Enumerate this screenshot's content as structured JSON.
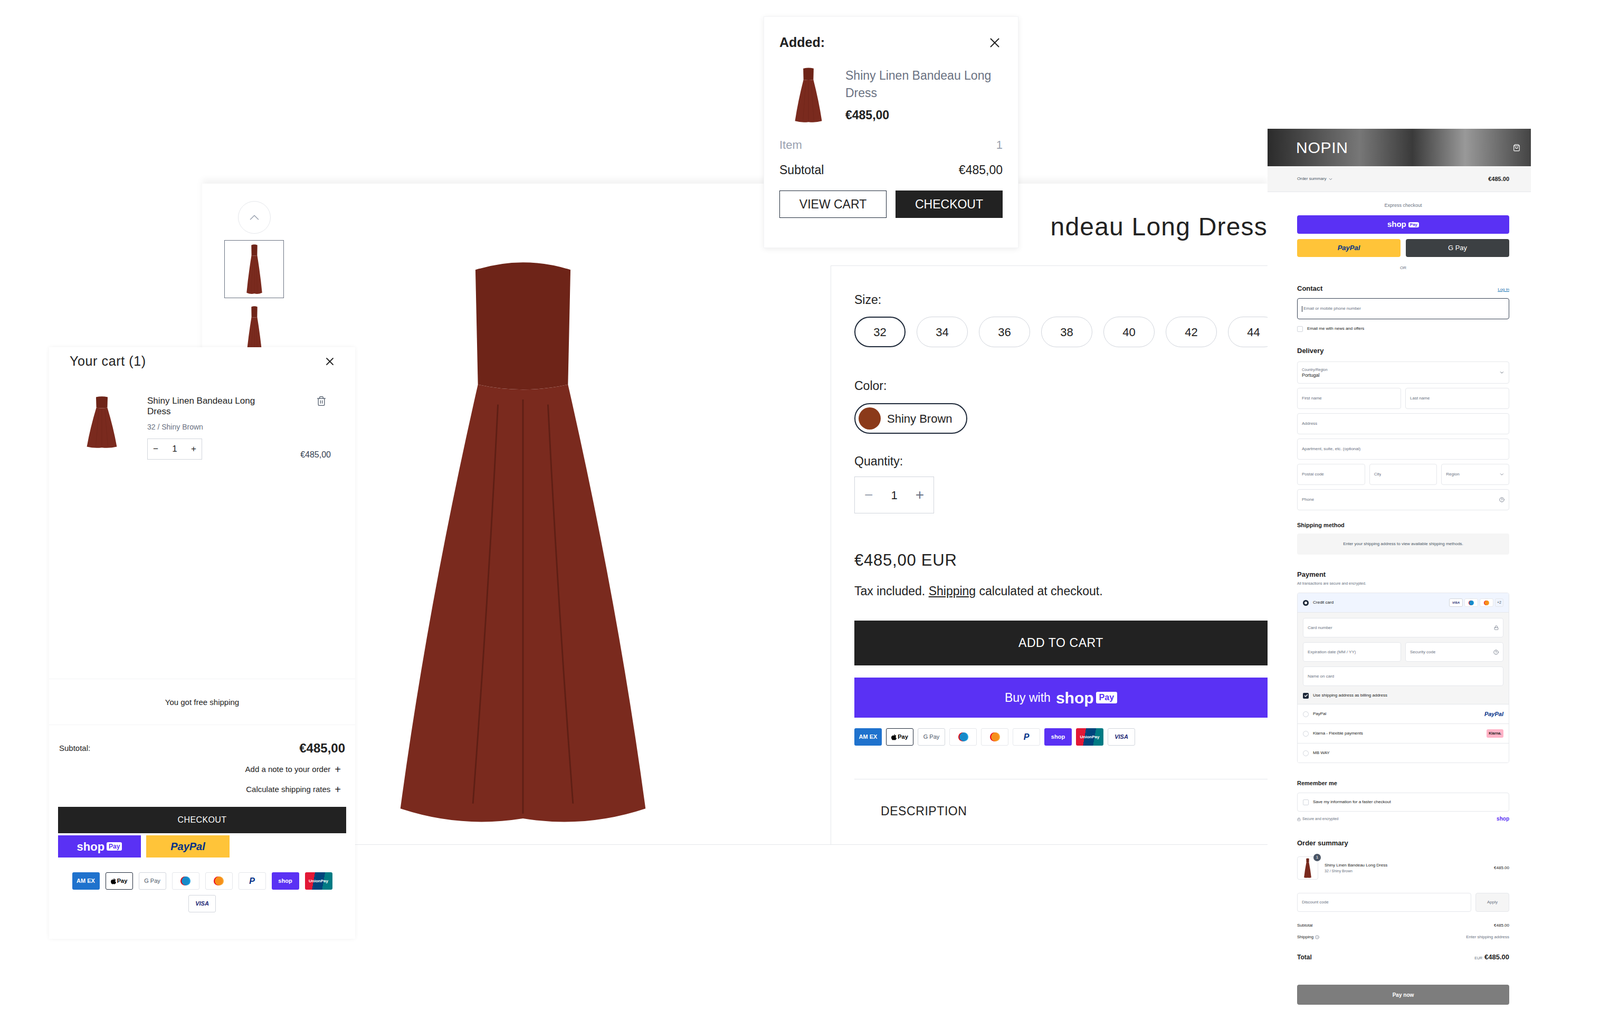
{
  "product_page": {
    "title_visible": "ndeau Long Dress",
    "size_label": "Size:",
    "sizes": [
      {
        "label": "32",
        "selected": true
      },
      {
        "label": "34",
        "selected": false
      },
      {
        "label": "36",
        "selected": false
      },
      {
        "label": "38",
        "selected": false
      },
      {
        "label": "40",
        "selected": false
      },
      {
        "label": "42",
        "selected": false
      },
      {
        "label": "44",
        "selected": false
      }
    ],
    "color_label": "Color:",
    "colors": [
      {
        "label": "Shiny Brown",
        "selected": true,
        "color": "#8b3a1a"
      }
    ],
    "quantity_label": "Quantity:",
    "quantity": {
      "decrement": "−",
      "value": "1",
      "increment": "+"
    },
    "price": "€485,00 EUR",
    "tax_before": "Tax included. ",
    "tax_link": "Shipping",
    "tax_after": " calculated at checkout.",
    "add_to_cart": "ADD TO CART",
    "buy_with": "Buy with",
    "shop_pay": {
      "shop": "shop",
      "pay": "Pay"
    },
    "payment_icons": [
      {
        "kind": "amex",
        "label": "AM EX"
      },
      {
        "kind": "applepay",
        "label": "Pay"
      },
      {
        "kind": "gpay",
        "label": "G Pay"
      },
      {
        "kind": "maestro",
        "label": ""
      },
      {
        "kind": "mastercard",
        "label": ""
      },
      {
        "kind": "paypal",
        "label": "P"
      },
      {
        "kind": "shop",
        "label": "shop"
      },
      {
        "kind": "unionpay",
        "label": "UnionPay"
      },
      {
        "kind": "visa",
        "label": "VISA"
      }
    ],
    "description": "DESCRIPTION"
  },
  "added_popup": {
    "heading": "Added:",
    "item_name": "Shiny Linen Bandeau Long Dress",
    "item_price": "€485,00",
    "item_label": "Item",
    "item_count": "1",
    "subtotal_label": "Subtotal",
    "subtotal": "€485,00",
    "buttons": [
      {
        "label": "VIEW CART",
        "kind": "outline"
      },
      {
        "label": "CHECKOUT",
        "kind": "solid"
      }
    ]
  },
  "cart_drawer": {
    "title": "Your cart (1)",
    "item": {
      "name": "Shiny Linen Bandeau Long Dress",
      "variant": "32 / Shiny Brown",
      "decrement": "−",
      "quantity": "1",
      "increment": "+",
      "price": "€485,00"
    },
    "free_shipping": "You got free shipping",
    "subtotal_label": "Subtotal:",
    "subtotal": "€485,00",
    "links": [
      {
        "label": "Add a note to your order",
        "icon": "+"
      },
      {
        "label": "Calculate shipping rates",
        "icon": "+"
      }
    ],
    "checkout": "CHECKOUT",
    "shop_pay": {
      "shop": "shop",
      "pay": "Pay"
    },
    "paypal": "PayPal",
    "payment_icons": [
      {
        "kind": "amex",
        "label": "AM EX"
      },
      {
        "kind": "applepay",
        "label": "Pay"
      },
      {
        "kind": "gpay",
        "label": "G Pay"
      },
      {
        "kind": "maestro",
        "label": ""
      },
      {
        "kind": "mastercard",
        "label": ""
      },
      {
        "kind": "paypal",
        "label": "P"
      },
      {
        "kind": "shop",
        "label": "shop"
      },
      {
        "kind": "unionpay",
        "label": "UnionPay"
      },
      {
        "kind": "visa",
        "label": "VISA"
      }
    ]
  },
  "checkout": {
    "logo": "NOPIN",
    "summary_toggle": "Order summary",
    "summary_total": "€485.00",
    "express_label": "Express checkout",
    "express_shop": {
      "shop": "shop",
      "pay": "Pay"
    },
    "express_paypal": "PayPal",
    "express_gpay": "G Pay",
    "or": "OR",
    "contact_heading": "Contact",
    "login": "Log in",
    "email_placeholder": "Email or mobile phone number",
    "news_checkbox": {
      "label": "Email me with news and offers",
      "checked": false
    },
    "delivery_heading": "Delivery",
    "country": {
      "label": "Country/Region",
      "value": "Portugal"
    },
    "delivery_rows": [
      [
        {
          "placeholder": "First name",
          "kind": "text"
        },
        {
          "placeholder": "Last name",
          "kind": "text"
        }
      ],
      [
        {
          "placeholder": "Address",
          "kind": "text"
        }
      ],
      [
        {
          "placeholder": "Apartment, suite, etc. (optional)",
          "kind": "text"
        }
      ],
      [
        {
          "placeholder": "Postal code",
          "kind": "text"
        },
        {
          "placeholder": "City",
          "kind": "text"
        },
        {
          "placeholder": "Region",
          "kind": "select"
        }
      ],
      [
        {
          "placeholder": "Phone",
          "kind": "help"
        }
      ]
    ],
    "shipping_heading": "Shipping method",
    "shipping_note": "Enter your shipping address to view available shipping methods.",
    "payment_heading": "Payment",
    "payment_sub": "All transactions are secure and encrypted.",
    "card_icons": [
      {
        "kind": "visa",
        "label": "VISA"
      },
      {
        "kind": "maestro",
        "label": ""
      },
      {
        "kind": "mastercard",
        "label": ""
      }
    ],
    "card_more": "+2",
    "card_fields": [
      [
        {
          "placeholder": "Card number",
          "kind": "lock"
        }
      ],
      [
        {
          "placeholder": "Expiration date (MM / YY)",
          "kind": "text"
        },
        {
          "placeholder": "Security code",
          "kind": "help"
        }
      ],
      [
        {
          "placeholder": "Name on card",
          "kind": "text"
        }
      ]
    ],
    "billing_checkbox": {
      "label": "Use shipping address as billing address",
      "checked": true
    },
    "payment_methods": [
      {
        "label": "Credit card",
        "selected": true,
        "kind": "card",
        "logo": ""
      },
      {
        "label": "PayPal",
        "selected": false,
        "kind": "paypal",
        "logo": "PayPal"
      },
      {
        "label": "Klarna - Flexible payments",
        "selected": false,
        "kind": "klarna",
        "logo": "Klarna."
      },
      {
        "label": "MB WAY",
        "selected": false,
        "kind": "plain",
        "logo": ""
      }
    ],
    "remember_heading": "Remember me",
    "remember_checkbox": {
      "label": "Save my information for a faster checkout",
      "checked": false
    },
    "secure_note": "Secure and encrypted",
    "shop_mark": "shop",
    "order_heading": "Order summary",
    "item": {
      "quantity": "1",
      "name": "Shiny Linen Bandeau Long Dress",
      "variant": "32 / Shiny Brown",
      "price": "€485.00"
    },
    "discount_placeholder": "Discount code",
    "apply": "Apply",
    "subtotal_label": "Subtotal",
    "subtotal": "€485.00",
    "shipping_label": "Shipping",
    "shipping_value": "Enter shipping address",
    "total_label": "Total",
    "currency": "EUR",
    "total": "€485.00",
    "pay_now": "Pay now"
  }
}
